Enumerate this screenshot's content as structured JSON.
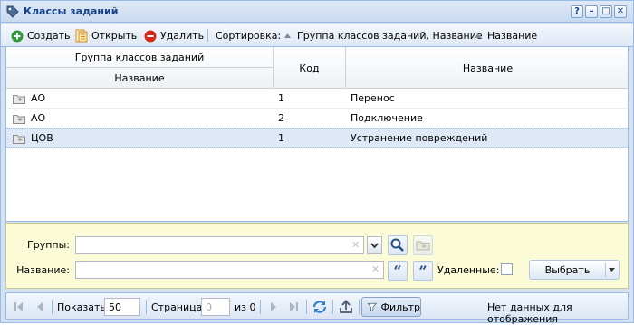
{
  "window": {
    "title": "Классы заданий",
    "buttons": [
      "?",
      "–",
      "□",
      "✕"
    ]
  },
  "toolbar": {
    "create": "Создать",
    "open": "Открыть",
    "delete": "Удалить",
    "sort_label": "Сортировка:",
    "sort_items": [
      "Группа классов заданий, Название",
      "Название"
    ]
  },
  "grid": {
    "group_header": "Группа классов заданий",
    "group_sub_header": "Название",
    "code_header": "Код",
    "name_header": "Название",
    "rows": [
      {
        "group": "АО",
        "code": "1",
        "name": "Перенос"
      },
      {
        "group": "АО",
        "code": "2",
        "name": "Подключение"
      },
      {
        "group": "ЦОВ",
        "code": "1",
        "name": "Устранение повреждений"
      }
    ],
    "selected_row_index": 2
  },
  "filter": {
    "groups_label": "Группы:",
    "groups_value": "",
    "name_label": "Название:",
    "name_value": "",
    "deleted_label": "Удаленные:",
    "select_button": "Выбрать"
  },
  "statusbar": {
    "show_label": "Показать",
    "page_size": "50",
    "page_label": "Страница",
    "page_value": "0",
    "of_label": "из 0",
    "filter_button": "Фильтр",
    "status_text": "Нет данных для отображения"
  },
  "colors": {
    "title": "#15428b",
    "border": "#99bbe8",
    "filter_bg": "#fbfbd7",
    "selected_row": "#dfe8f6"
  }
}
